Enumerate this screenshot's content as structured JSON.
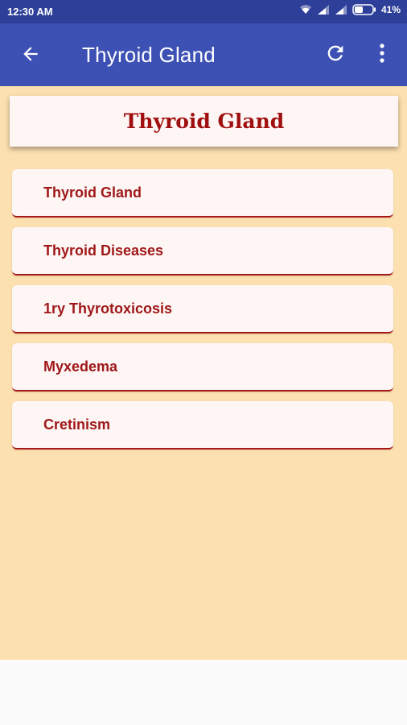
{
  "status_bar": {
    "time": "12:30 AM",
    "battery": "41%"
  },
  "app_bar": {
    "title": "Thyroid Gland",
    "back_icon": "arrow-left-icon",
    "refresh_icon": "refresh-icon",
    "menu_icon": "more-vert-icon"
  },
  "header": {
    "title": "Thyroid Gland"
  },
  "list": {
    "items": [
      {
        "label": "Thyroid Gland"
      },
      {
        "label": "Thyroid Diseases"
      },
      {
        "label": "1ry Thyrotoxicosis"
      },
      {
        "label": "Myxedema"
      },
      {
        "label": "Cretinism"
      }
    ]
  },
  "colors": {
    "primary": "#3d51b5",
    "primary_dark": "#2e3f9a",
    "background": "#fde0b0",
    "card": "#fdf6f4",
    "accent_text": "#a0181a"
  }
}
